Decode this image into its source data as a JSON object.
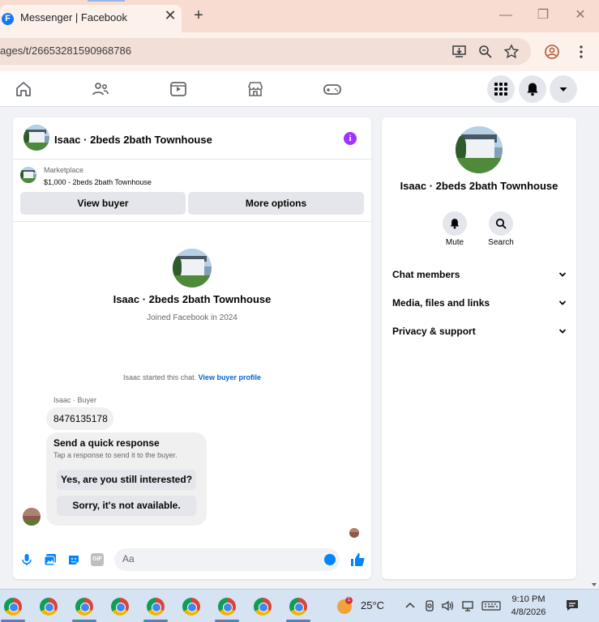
{
  "browser": {
    "tab_title": "Messenger | Facebook",
    "tab_favicon": "F",
    "tab_close": "✕",
    "new_tab": "+",
    "url": "ages/t/26653281590968786",
    "window_controls": {
      "minimize": "—",
      "restore": "❐",
      "close": "✕"
    }
  },
  "fb_nav": {
    "icons": [
      "home-icon",
      "friends-icon",
      "watch-icon",
      "marketplace-icon",
      "gaming-icon"
    ],
    "right_icons": [
      "menu-grid-icon",
      "notifications-bell-icon",
      "account-caret-icon"
    ]
  },
  "chat_header": {
    "title": "Isaac · 2beds 2bath Townhouse",
    "info_glyph": "i"
  },
  "marketplace": {
    "label": "Marketplace",
    "listing": "$1,000 - 2beds 2bath Townhouse",
    "view_buyer": "View buyer",
    "more_options": "More options"
  },
  "intro": {
    "name": "Isaac · 2beds 2bath Townhouse",
    "joined": "Joined Facebook in 2024",
    "started_text": "Isaac started this chat.",
    "started_link": "View buyer profile"
  },
  "messages": {
    "sender": "Isaac · Buyer",
    "phone": "8476135178",
    "quick_title": "Send a quick response",
    "quick_sub": "Tap a response to send it to the buyer.",
    "options": [
      "Yes, are you still interested?",
      "Sorry, it's not available."
    ]
  },
  "composer": {
    "placeholder": "Aa",
    "gif_label": "GIF"
  },
  "details": {
    "name": "Isaac · 2beds 2bath Townhouse",
    "mute": "Mute",
    "search": "Search",
    "sections": [
      "Chat members",
      "Media, files and links",
      "Privacy & support"
    ]
  },
  "taskbar": {
    "weather_badge": "1",
    "temperature": "25°C",
    "time": "9:10 PM",
    "date": "4/8/2026"
  },
  "colors": {
    "fb_blue": "#0084ff",
    "info_purple": "#a033ff",
    "link_blue": "#0064d1"
  }
}
